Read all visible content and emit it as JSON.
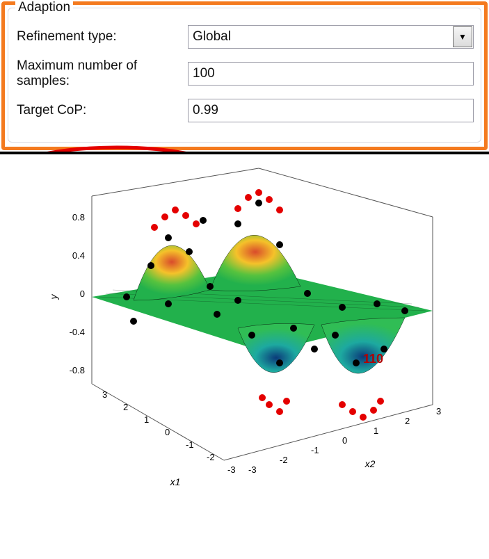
{
  "panel": {
    "title": "Adaption",
    "rows": {
      "refinement": {
        "label": "Refinement type:",
        "value": "Global"
      },
      "maxsamples": {
        "label": "Maximum number of samples:",
        "value": "100"
      },
      "targetcop": {
        "label": "Target CoP:",
        "value": "0.99"
      }
    }
  },
  "chart_data": {
    "type": "surface3d",
    "title": "",
    "xlabel": "x1",
    "ylabel": "x2",
    "zlabel": "y",
    "x_ticks": [
      -3,
      -2,
      -1,
      0,
      1,
      2,
      3
    ],
    "y_ticks": [
      -3,
      -2,
      -1,
      0,
      1,
      2,
      3
    ],
    "z_ticks": [
      -0.8,
      -0.4,
      0,
      0.4,
      0.8
    ],
    "xlim": [
      -3,
      3
    ],
    "ylim": [
      -3,
      3
    ],
    "zlim": [
      -1,
      1
    ],
    "annotation": "110",
    "surface_note": "two gaussian-like peaks (~1) and two valleys (~-1); sample points in black, refinement points in red clustered near extrema"
  }
}
